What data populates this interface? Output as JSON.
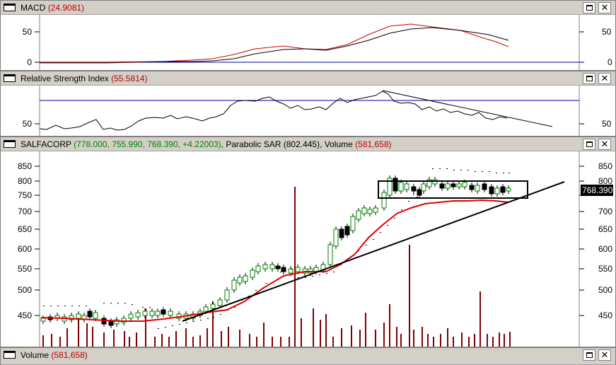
{
  "panels": {
    "macd": {
      "name": "MACD",
      "value": "(24.9081)",
      "axis_labels": [
        "50",
        "0"
      ]
    },
    "rsi": {
      "name": "Relative Strength Index",
      "value": "(55.5814)",
      "axis_labels": [
        "50"
      ]
    },
    "price": {
      "name": "SALFACORP",
      "ohlc": "(778.000, 755.990, 768.390, +4.22003)",
      "sar_label": "Parabolic SAR",
      "sar_value": "(802.445)",
      "volume_label": "Volume",
      "volume_value": "(581,658)",
      "last_price": "768.390",
      "axis_labels": [
        "850",
        "800",
        "750",
        "700",
        "650",
        "600",
        "550",
        "500",
        "450"
      ]
    },
    "volume": {
      "name": "Volume",
      "value": "(581,658)"
    }
  },
  "window_buttons": {
    "maximize": "□",
    "close": "✕"
  },
  "colors": {
    "up": "#008000",
    "down": "#000000",
    "ma": "#e00000",
    "sar": "#000000",
    "volume": "#800000",
    "macd_signal": "#d00000",
    "rsi_ref": "#0000a0"
  }
}
